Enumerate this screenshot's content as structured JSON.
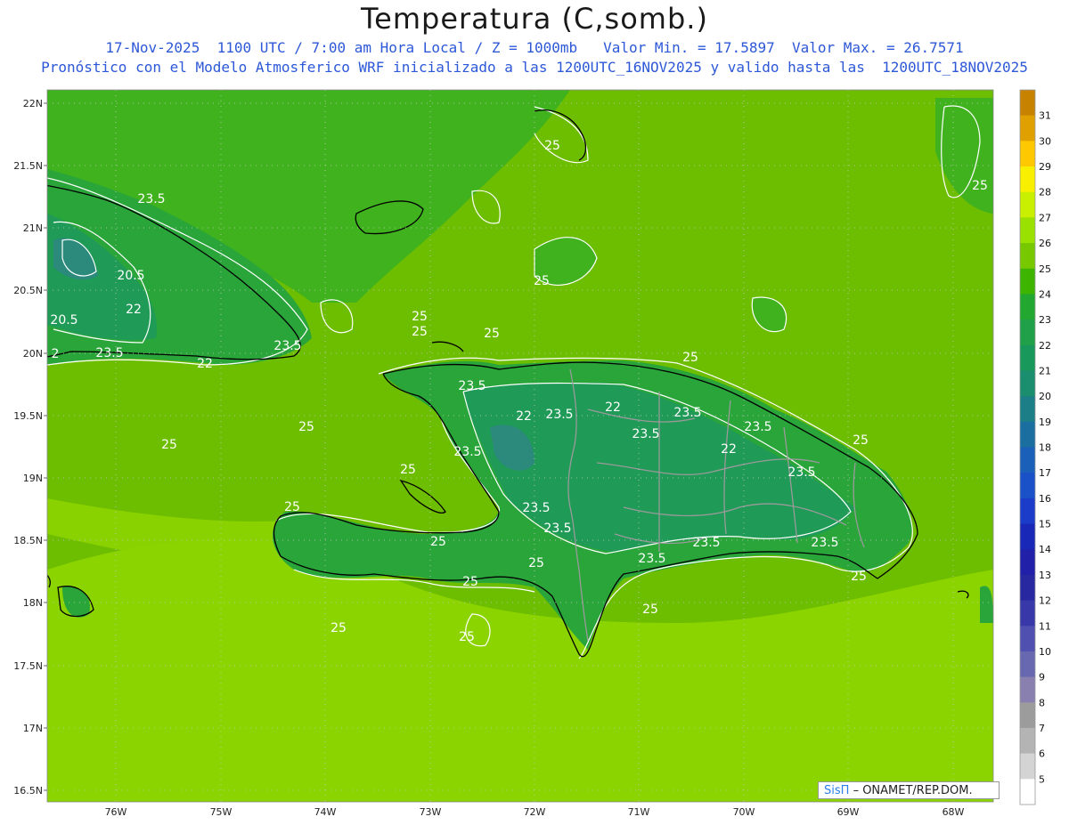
{
  "header": {
    "title": "Temperatura (C,somb.)",
    "line1": "17-Nov-2025  1100 UTC / 7:00 am Hora Local / Z = 1000mb   Valor Min. = 17.5897  Valor Max. = 26.7571",
    "line2": "Pronóstico con el Modelo Atmosferico WRF inicializado a las 1200UTC_16NOV2025 y valido hasta las  1200UTC_18NOV2025"
  },
  "map": {
    "lat_labels": [
      "22N",
      "21.5N",
      "21N",
      "20.5N",
      "20N",
      "19.5N",
      "19N",
      "18.5N",
      "18N",
      "17.5N",
      "17N",
      "16.5N"
    ],
    "lon_labels": [
      "76W",
      "75W",
      "74W",
      "73W",
      "72W",
      "71W",
      "70W",
      "69W",
      "68W"
    ],
    "contour_labels": [
      "25",
      "23.5",
      "20.5",
      "22",
      "25",
      "25",
      "25",
      "23.5",
      "22",
      "23.5",
      "22",
      "23.5",
      "25",
      "25",
      "23.5",
      "25",
      "25",
      "23.5",
      "25",
      "23.5",
      "22",
      "25",
      "23.5",
      "25",
      "25",
      "25",
      "23.5",
      "23.5",
      "25",
      "25",
      "25",
      "20.5",
      "2",
      "23.5",
      "22",
      "25",
      "25"
    ],
    "colors": {
      "sea_light": "#8cd400",
      "sea_mid": "#6dbd00",
      "land_dark": "#2aa53a",
      "land_mid": "#43b12b",
      "cold": "#2b8a7c",
      "coast": "#000000",
      "border": "#9a9a9a",
      "contour": "#ffffff"
    }
  },
  "colorbar": {
    "ticks": [
      "31",
      "30",
      "29",
      "28",
      "27",
      "26",
      "25",
      "24",
      "23",
      "22",
      "21",
      "20",
      "19",
      "18",
      "17",
      "16",
      "15",
      "14",
      "13",
      "12",
      "11",
      "10",
      "9",
      "8",
      "7",
      "6",
      "5"
    ],
    "colors": [
      "#c78200",
      "#e0a000",
      "#ffc800",
      "#f8f000",
      "#c8f000",
      "#9ae000",
      "#78c800",
      "#3cb400",
      "#22a830",
      "#20a048",
      "#18985a",
      "#1a8e6e",
      "#1c7e86",
      "#1a6ea0",
      "#1a60b8",
      "#1a50c8",
      "#1a3cc8",
      "#1a28b8",
      "#2020a8",
      "#2828a0",
      "#3838a8",
      "#5050b0",
      "#6868b0",
      "#8a80b0",
      "#9c9c9c",
      "#b4b4b4",
      "#d4d4d4",
      "#ffffff"
    ]
  },
  "credit": {
    "logo": "SisΠ",
    "text": "– ONAMET/REP.DOM."
  }
}
